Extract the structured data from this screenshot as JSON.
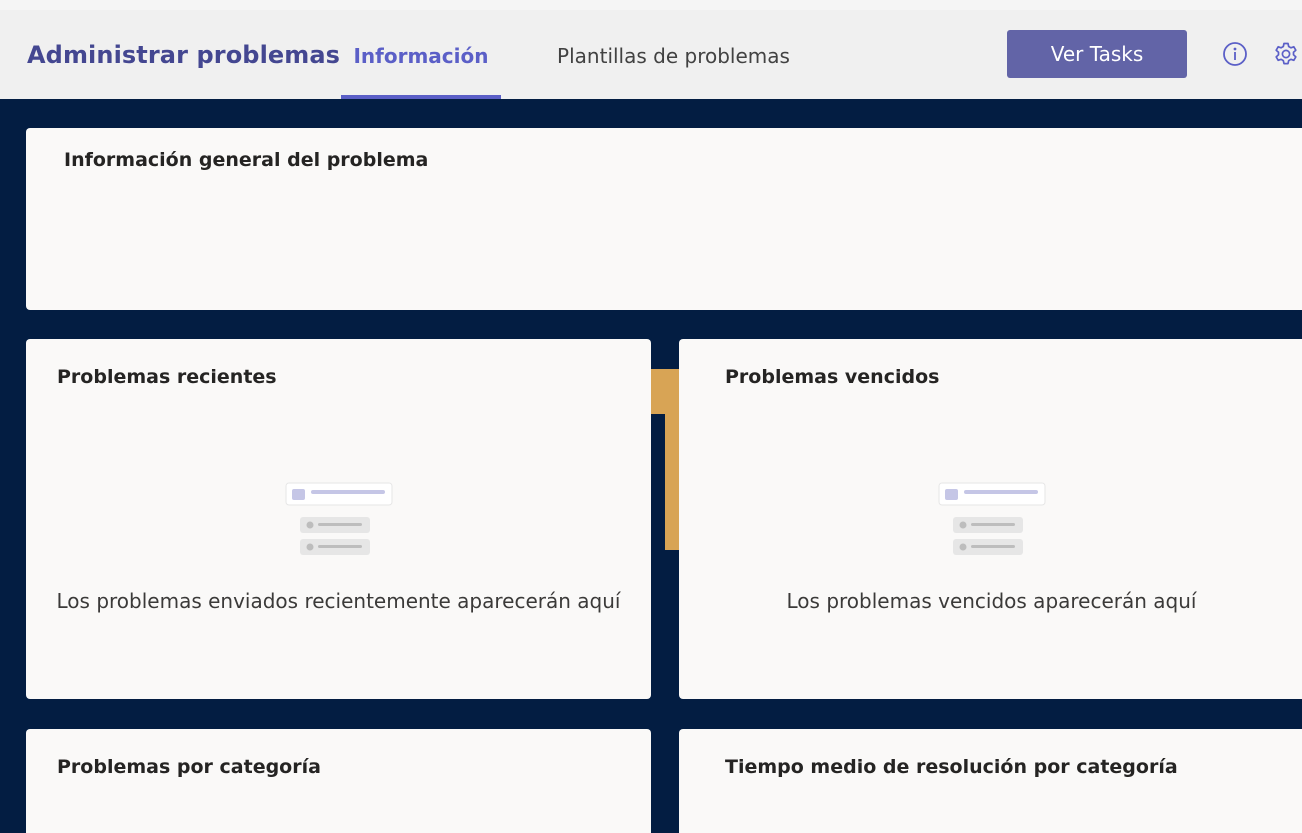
{
  "header": {
    "title": "Administrar problemas",
    "tabs": [
      {
        "label": "Información",
        "active": true
      },
      {
        "label": "Plantillas de problemas",
        "active": false
      }
    ],
    "primary_button": "Ver Tasks",
    "icons": [
      "info-icon",
      "gear-icon"
    ]
  },
  "cards": {
    "overview": {
      "title": "Información general del problema"
    },
    "recent": {
      "title": "Problemas recientes",
      "empty_message": "Los problemas enviados recientemente aparecerán aquí"
    },
    "overdue": {
      "title": "Problemas vencidos",
      "empty_message": "Los problemas vencidos aparecerán aquí"
    },
    "by_category": {
      "title": "Problemas por categoría"
    },
    "resolution_time": {
      "title": "Tiempo medio de resolución por categoría"
    }
  },
  "colors": {
    "background": "#031d42",
    "accent": "#6264a7",
    "active_tab": "#5b5fc7",
    "card": "#faf9f8",
    "gold": "#d8a455"
  }
}
